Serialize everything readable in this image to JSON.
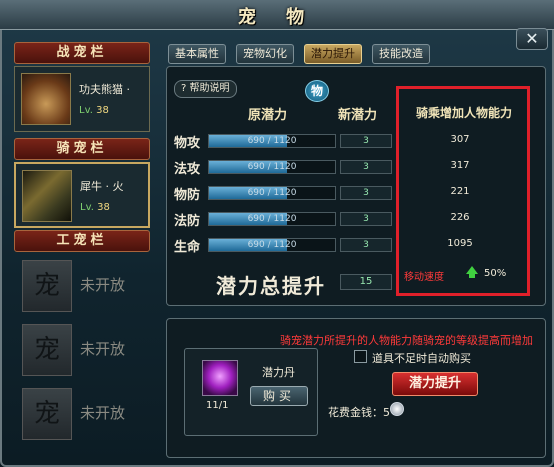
{
  "window": {
    "title": "宠 物",
    "close_label": "✕"
  },
  "sidebar": {
    "battle_header": "战宠栏",
    "battle_pet": {
      "name": "功夫熊猫 ·",
      "level_label": "Lv.",
      "level": "38"
    },
    "mount_header": "骑宠栏",
    "mount_pet": {
      "name": "犀牛 · 火",
      "level_label": "Lv.",
      "level": "38"
    },
    "work_header": "工宠栏",
    "locked_glyph": "宠",
    "locked_label": "未开放"
  },
  "tabs": [
    {
      "label": "基本属性",
      "active": false
    },
    {
      "label": "宠物幻化",
      "active": false
    },
    {
      "label": "潜力提升",
      "active": true
    },
    {
      "label": "技能改造",
      "active": false
    }
  ],
  "potential": {
    "help_label": "帮助说明",
    "badge": "物",
    "col_original": "原潜力",
    "col_new": "新潜力",
    "col_bonus": "骑乘增加人物能力",
    "rows": [
      {
        "label": "物攻",
        "current": 690,
        "max": 1120,
        "bar_text": "690 / 1120",
        "new": "3",
        "bonus": "307"
      },
      {
        "label": "法攻",
        "current": 690,
        "max": 1120,
        "bar_text": "690 / 1120",
        "new": "3",
        "bonus": "317"
      },
      {
        "label": "物防",
        "current": 690,
        "max": 1120,
        "bar_text": "690 / 1120",
        "new": "3",
        "bonus": "221"
      },
      {
        "label": "法防",
        "current": 690,
        "max": 1120,
        "bar_text": "690 / 1120",
        "new": "3",
        "bonus": "226"
      },
      {
        "label": "生命",
        "current": 690,
        "max": 1120,
        "bar_text": "690 / 1120",
        "new": "3",
        "bonus": "1095"
      }
    ],
    "total_label": "潜力总提升",
    "total_value": "15",
    "speed_label": "移动速度",
    "speed_value": "50%"
  },
  "upgrade": {
    "notice": "骑宠潜力所提升的人物能力随骑宠的等级提高而增加",
    "item_name": "潜力丹",
    "item_count": "11/1",
    "buy_label": "购买",
    "auto_buy_label": "道具不足时自动购买",
    "upgrade_button": "潜力提升",
    "cost_label": "花费金钱：5"
  },
  "colors": {
    "highlight_border": "#e0202a",
    "warning_text": "#ff3a3a",
    "bar_fill": "#3d8fc0"
  }
}
